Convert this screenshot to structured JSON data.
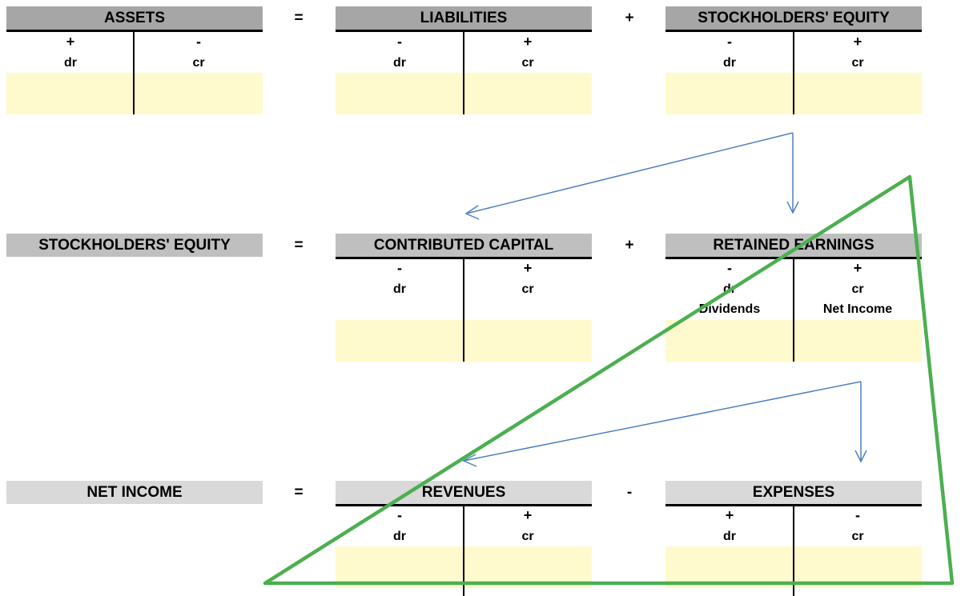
{
  "row1": {
    "left": {
      "title": "ASSETS",
      "dr_sign": "+",
      "cr_sign": "-",
      "dr": "dr",
      "cr": "cr"
    },
    "op1": "=",
    "middle": {
      "title": "LIABILITIES",
      "dr_sign": "-",
      "cr_sign": "+",
      "dr": "dr",
      "cr": "cr"
    },
    "op2": "+",
    "right": {
      "title": "STOCKHOLDERS' EQUITY",
      "dr_sign": "-",
      "cr_sign": "+",
      "dr": "dr",
      "cr": "cr"
    }
  },
  "row2": {
    "left": {
      "title": "STOCKHOLDERS' EQUITY"
    },
    "op1": "=",
    "middle": {
      "title": "CONTRIBUTED CAPITAL",
      "dr_sign": "-",
      "cr_sign": "+",
      "dr": "dr",
      "cr": "cr"
    },
    "op2": "+",
    "right": {
      "title": "RETAINED EARNINGS",
      "dr_sign": "-",
      "cr_sign": "+",
      "dr": "dr",
      "cr": "cr",
      "dr_item": "Dividends",
      "cr_item": "Net Income"
    }
  },
  "row3": {
    "left": {
      "title": "NET INCOME"
    },
    "op1": "=",
    "middle": {
      "title": "REVENUES",
      "dr_sign": "-",
      "cr_sign": "+",
      "dr": "dr",
      "cr": "cr"
    },
    "op2": "-",
    "right": {
      "title": "EXPENSES",
      "dr_sign": "+",
      "cr_sign": "-",
      "dr": "dr",
      "cr": "cr"
    }
  },
  "colors": {
    "row1_header": "#a6a6a6",
    "row2_header": "#bfbfbf",
    "row3_header": "#d9d9d9",
    "entry_fill": "#fffacd",
    "arrow": "#4f81bd",
    "triangle": "#4caf50"
  }
}
